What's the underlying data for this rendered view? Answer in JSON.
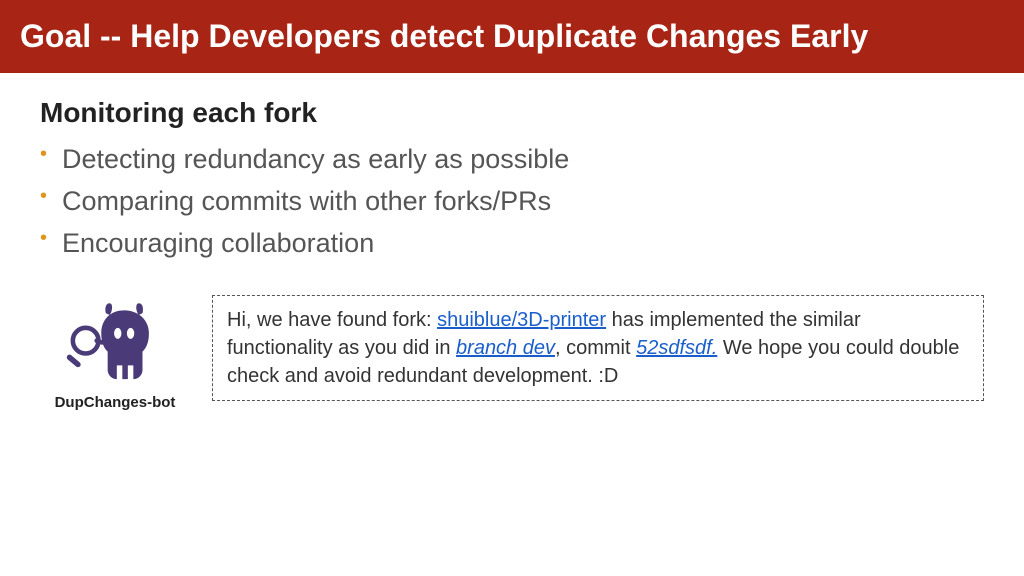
{
  "header": {
    "title": "Goal -- Help Developers detect Duplicate Changes Early"
  },
  "subtitle": "Monitoring each fork",
  "bullets": [
    "Detecting redundancy as early as possible",
    "Comparing commits with other forks/PRs",
    "Encouraging collaboration"
  ],
  "bot": {
    "name": "DupChanges-bot"
  },
  "message": {
    "part1": "Hi, we have found fork: ",
    "link1": "shuiblue/3D-printer",
    "part2": " has implemented the similar functionality as you did in ",
    "link2": "branch dev",
    "part3": ", commit ",
    "link3": "52sdfsdf.",
    "part4": " We hope you could double check and avoid redundant development. :D"
  }
}
